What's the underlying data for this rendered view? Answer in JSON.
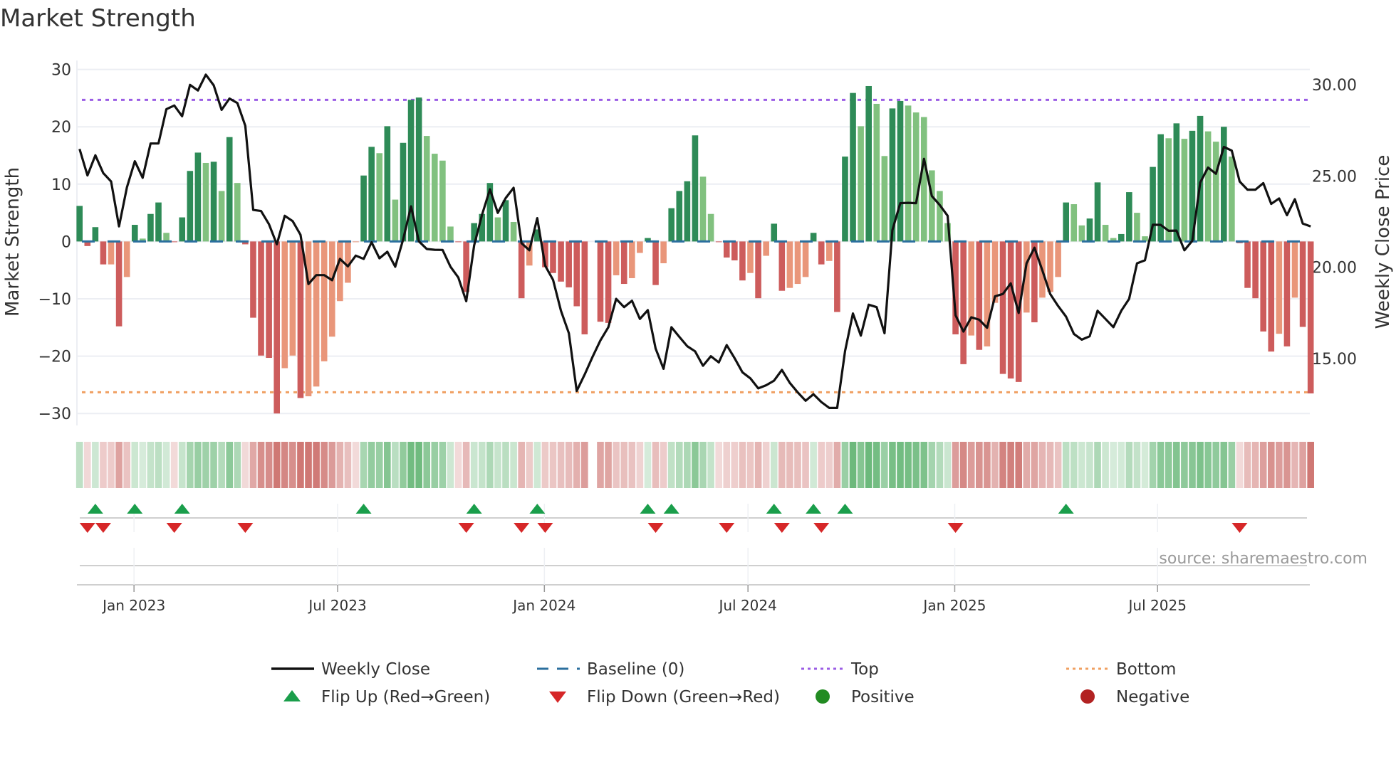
{
  "title": "Market Strength",
  "source_note": "source: sharemaestro.com",
  "chart_data": {
    "type": "bar",
    "title": "Market Strength",
    "ylabel": "Market Strength",
    "y2label": "Weekly Close Price",
    "ylim": [
      -32,
      32
    ],
    "y2lim": [
      11.5,
      31.3
    ],
    "yticks": [
      "30",
      "20",
      "10",
      "0",
      "−10",
      "−20",
      "−30"
    ],
    "ytick_values": [
      30,
      20,
      10,
      0,
      -10,
      -20,
      -30
    ],
    "y2ticks": [
      "30.00",
      "25.00",
      "20.00",
      "15.00"
    ],
    "y2tick_values": [
      30,
      25,
      20,
      15
    ],
    "x_ticks": [
      {
        "label": "Jan 2023",
        "week": 6.9
      },
      {
        "label": "Jul 2023",
        "week": 32.7
      },
      {
        "label": "Jan 2024",
        "week": 58.9
      },
      {
        "label": "Jul 2024",
        "week": 84.7
      },
      {
        "label": "Jan 2025",
        "week": 110.9
      },
      {
        "label": "Jul 2025",
        "week": 136.6
      }
    ],
    "grid": true,
    "top_level": 24.7,
    "bottom_level": -26.3,
    "baseline": 0,
    "strength": [
      6.2,
      -0.8,
      2.5,
      -4.0,
      -4.0,
      -14.8,
      -6.2,
      2.9,
      0.5,
      4.8,
      6.8,
      1.5,
      -0.1,
      4.2,
      12.3,
      15.5,
      13.7,
      13.9,
      8.8,
      18.2,
      10.2,
      -0.5,
      -13.3,
      -19.9,
      -20.3,
      -30.0,
      -22.1,
      -19.9,
      -27.3,
      -27.0,
      -25.3,
      -20.9,
      -16.6,
      -10.4,
      -7.2,
      -0.1,
      11.5,
      16.5,
      15.4,
      20.1,
      7.3,
      17.2,
      24.7,
      25.1,
      18.4,
      15.3,
      14.1,
      2.6,
      -0.1,
      -8.8,
      3.2,
      4.8,
      10.2,
      4.2,
      7.2,
      3.4,
      -9.9,
      -4.2,
      2.1,
      -4.5,
      -5.5,
      -7.0,
      -8.0,
      -11.3,
      -16.2,
      null,
      -14.0,
      -14.2,
      -5.9,
      -7.4,
      -6.4,
      -2.0,
      0.6,
      -7.6,
      -3.8,
      5.8,
      8.8,
      10.5,
      18.5,
      11.3,
      4.8,
      -0.1,
      -2.8,
      -3.3,
      -6.8,
      -5.5,
      -9.9,
      -2.5,
      3.1,
      -8.6,
      -8.1,
      -7.4,
      -6.2,
      1.5,
      -4.0,
      -3.4,
      -12.3,
      14.8,
      25.9,
      20.1,
      27.1,
      24.0,
      14.9,
      23.2,
      24.5,
      23.7,
      22.5,
      21.7,
      12.4,
      8.8,
      3.2,
      -16.2,
      -21.4,
      -16.4,
      -18.9,
      -18.3,
      -10.7,
      -23.1,
      -23.9,
      -24.5,
      -12.4,
      -14.1,
      -9.8,
      -8.8,
      -6.2,
      6.8,
      6.5,
      2.8,
      4.0,
      10.3,
      2.9,
      0.6,
      1.3,
      8.6,
      5.0,
      0.9,
      13.0,
      18.7,
      18.0,
      20.6,
      17.9,
      19.3,
      21.9,
      19.2,
      17.4,
      20.0,
      14.8,
      -0.3,
      -8.1,
      -9.9,
      -15.7,
      -19.2,
      -16.1,
      -18.3,
      -9.8,
      -14.9,
      -26.5
    ],
    "weekly_close": [
      26.48,
      25.03,
      26.13,
      25.16,
      24.7,
      22.24,
      24.38,
      25.81,
      24.9,
      26.78,
      26.78,
      28.66,
      28.86,
      28.27,
      29.99,
      29.68,
      30.55,
      29.96,
      28.62,
      29.24,
      28.99,
      27.75,
      23.14,
      23.08,
      22.36,
      21.26,
      22.82,
      22.53,
      21.78,
      19.08,
      19.57,
      19.57,
      19.29,
      20.46,
      20.05,
      20.64,
      20.46,
      21.37,
      20.49,
      20.85,
      20.03,
      21.52,
      23.34,
      21.42,
      21.0,
      20.96,
      20.95,
      20.03,
      19.44,
      18.14,
      21.2,
      22.88,
      24.27,
      22.98,
      23.79,
      24.35,
      21.32,
      20.93,
      22.69,
      20.09,
      19.31,
      17.62,
      16.39,
      13.23,
      14.12,
      15.09,
      16.0,
      16.72,
      18.27,
      17.82,
      18.17,
      17.17,
      17.65,
      15.55,
      14.44,
      16.72,
      16.19,
      15.68,
      15.4,
      14.61,
      15.13,
      14.79,
      15.74,
      15.03,
      14.25,
      13.92,
      13.37,
      13.54,
      13.79,
      14.38,
      13.67,
      13.15,
      12.69,
      13.05,
      12.62,
      12.3,
      12.3,
      15.42,
      17.47,
      16.26,
      17.95,
      17.82,
      16.39,
      22.03,
      23.51,
      23.53,
      23.51,
      25.94,
      23.9,
      23.41,
      22.82,
      17.37,
      16.48,
      17.26,
      17.13,
      16.69,
      18.41,
      18.54,
      19.12,
      17.5,
      20.22,
      21.07,
      19.83,
      18.54,
      17.88,
      17.3,
      16.35,
      16.04,
      16.22,
      17.62,
      17.17,
      16.72,
      17.62,
      18.27,
      20.22,
      20.38,
      22.33,
      22.32,
      22.0,
      22.01,
      20.93,
      21.45,
      24.64,
      25.46,
      25.12,
      26.59,
      26.39,
      24.7,
      24.25,
      24.25,
      24.61,
      23.47,
      23.77,
      22.85,
      23.73,
      22.39,
      22.24
    ],
    "flip_up_weeks": [
      2,
      7,
      13,
      36,
      50,
      58,
      72,
      75,
      88,
      93,
      97,
      125
    ],
    "flip_down_weeks": [
      1,
      3,
      12,
      21,
      49,
      56,
      59,
      73,
      82,
      89,
      94,
      111,
      147
    ],
    "legend_placement": "bottom-center",
    "legend": [
      {
        "label": "Weekly Close",
        "kind": "line",
        "color": "#111111"
      },
      {
        "label": "Baseline (0)",
        "kind": "dash",
        "color": "#2b6f9e"
      },
      {
        "label": "Top",
        "kind": "dot",
        "color": "#9b5de5"
      },
      {
        "label": "Bottom",
        "kind": "dot",
        "color": "#f0a062"
      },
      {
        "label": "Flip Up (Red→Green)",
        "kind": "up",
        "color": "#1a9e4b"
      },
      {
        "label": "Flip Down (Green→Red)",
        "kind": "down",
        "color": "#d62728"
      },
      {
        "label": "Positive",
        "kind": "circle",
        "color": "#228b22"
      },
      {
        "label": "Negative",
        "kind": "circle",
        "color": "#b22222"
      }
    ],
    "colors": {
      "pos_strong": "#2e8b57",
      "pos_weak": "#81c17f",
      "neg_strong": "#cd5c5c",
      "neg_weak": "#e9967a",
      "grid": "#eceef3"
    }
  }
}
